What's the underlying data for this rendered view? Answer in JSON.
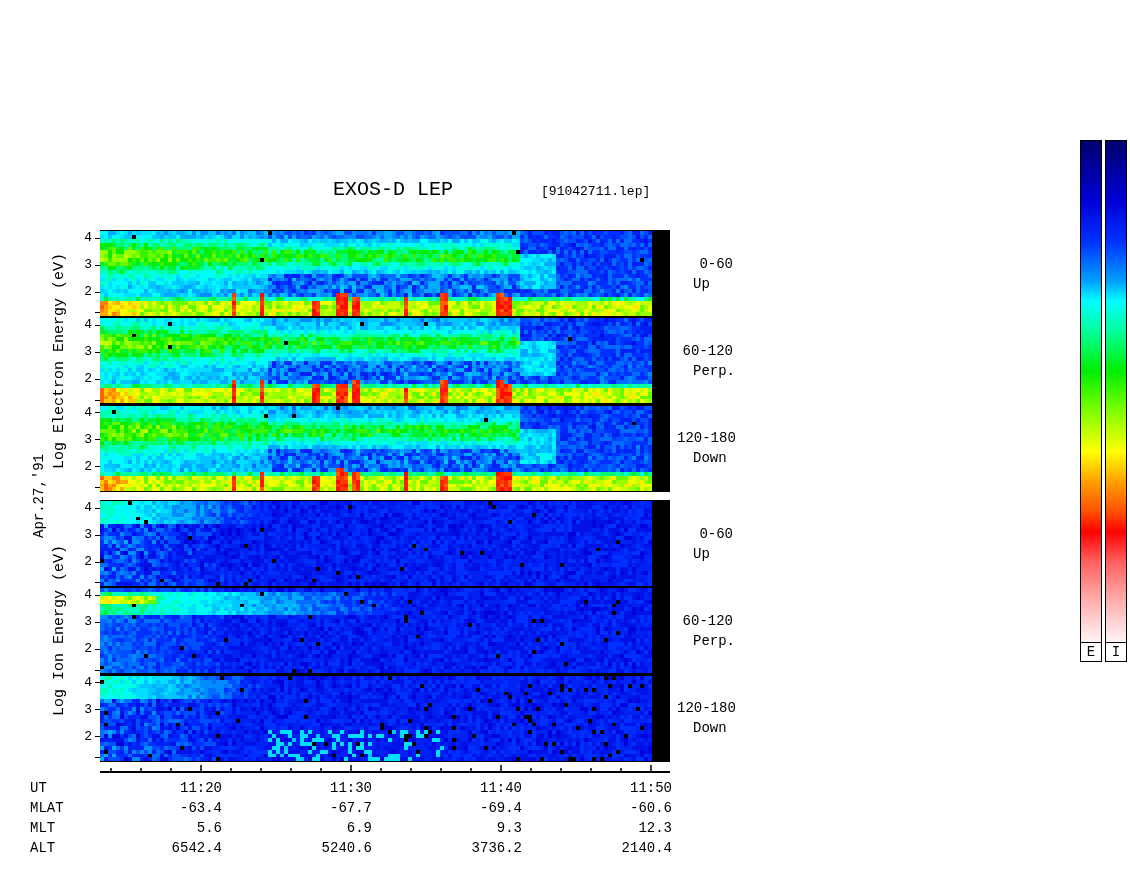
{
  "title": "EXOS-D LEP",
  "file": "[91042711.lep]",
  "date": "Apr.27,'91",
  "groups": [
    {
      "kind": "electron",
      "axis_label": "Log Electron Energy (eV)",
      "panels": [
        {
          "ticks": [
            "4",
            "3",
            "2"
          ],
          "angle": "0-60",
          "direction": "Up"
        },
        {
          "ticks": [
            "4",
            "3",
            "2"
          ],
          "angle": "60-120",
          "direction": "Perp."
        },
        {
          "ticks": [
            "4",
            "3",
            "2"
          ],
          "angle": "120-180",
          "direction": "Down"
        }
      ]
    },
    {
      "kind": "ion",
      "axis_label": "Log Ion Energy (eV)",
      "panels": [
        {
          "ticks": [
            "4",
            "3",
            "2"
          ],
          "angle": "0-60",
          "direction": "Up"
        },
        {
          "ticks": [
            "4",
            "3",
            "2"
          ],
          "angle": "60-120",
          "direction": "Perp."
        },
        {
          "ticks": [
            "4",
            "3",
            "2"
          ],
          "angle": "120-180",
          "direction": "Down"
        }
      ]
    }
  ],
  "time_axis": {
    "rows": [
      {
        "label": "UT",
        "values": [
          "11:20",
          "11:30",
          "11:40",
          "11:50"
        ]
      },
      {
        "label": "MLAT",
        "values": [
          "-63.4",
          "-67.7",
          "-69.4",
          "-60.6"
        ]
      },
      {
        "label": "MLT",
        "values": [
          "5.6",
          "6.9",
          "9.3",
          "12.3"
        ]
      },
      {
        "label": "ALT",
        "values": [
          "6542.4",
          "5240.6",
          "3736.2",
          "2140.4"
        ]
      }
    ]
  },
  "color_scales": [
    {
      "label": "E"
    },
    {
      "label": "I"
    }
  ]
}
